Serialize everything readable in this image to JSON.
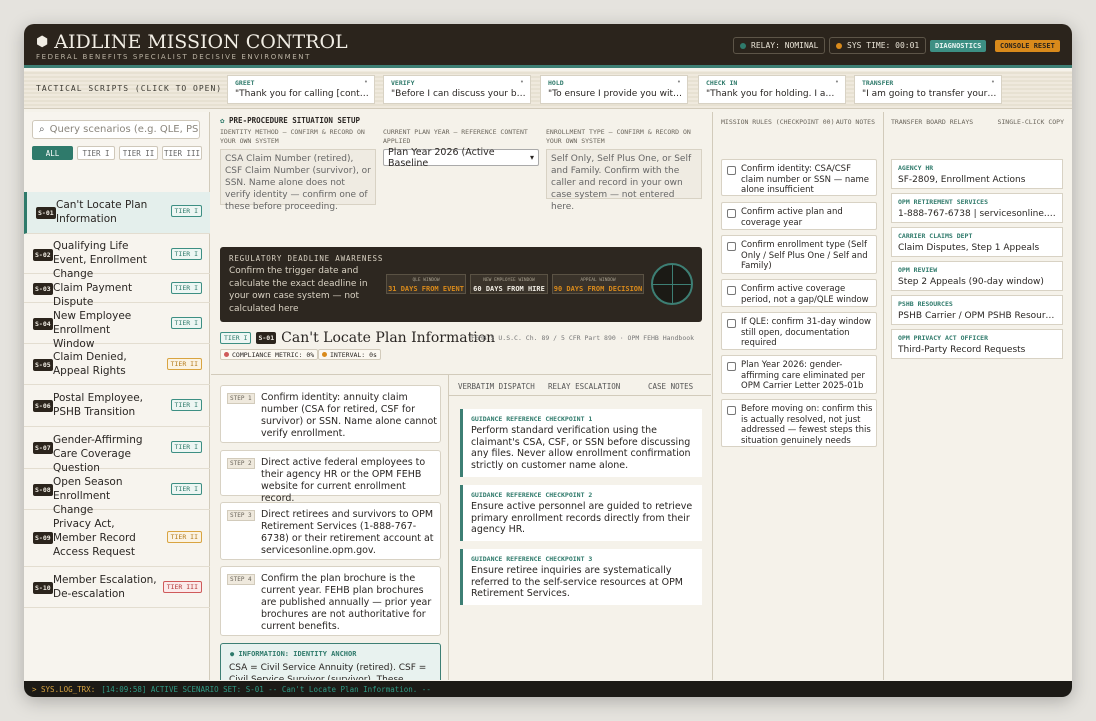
{
  "header": {
    "title": "AIDLINE MISSION CONTROL",
    "subtitle": "FEDERAL BENEFITS SPECIALIST DECISIVE ENVIRONMENT",
    "relay": "RELAY: NOMINAL",
    "systime": "SYS TIME: 00:01",
    "diagnostics": "DIAGNOSTICS",
    "reset": "CONSOLE RESET",
    "relay_color": "#2f7a6b",
    "time_color": "#d98a1b"
  },
  "scripts": {
    "label": "TACTICAL SCRIPTS (CLICK TO OPEN)",
    "items": [
      {
        "key": "GREET",
        "text": "\"Thank you for calling [contac..."
      },
      {
        "key": "VERIFY",
        "text": "\"Before I can discuss your be..."
      },
      {
        "key": "HOLD",
        "text": "\"To ensure I provide you with ..."
      },
      {
        "key": "CHECK IN",
        "text": "\"Thank you for holding. I am s..."
      },
      {
        "key": "TRANSFER",
        "text": "\"I am going to transfer your in..."
      }
    ]
  },
  "sidebar": {
    "search_placeholder": "Query scenarios (e.g. QLE, PSHB)",
    "filters": [
      "ALL",
      "TIER I",
      "TIER II",
      "TIER III"
    ],
    "items": [
      {
        "id": "S-01",
        "title": "Can't Locate Plan Information",
        "tier": "TIER I"
      },
      {
        "id": "S-02",
        "title": "Qualifying Life Event, Enrollment Change",
        "tier": "TIER I"
      },
      {
        "id": "S-03",
        "title": "Claim Payment Dispute",
        "tier": "TIER I"
      },
      {
        "id": "S-04",
        "title": "New Employee Enrollment Window",
        "tier": "TIER I"
      },
      {
        "id": "S-05",
        "title": "Claim Denied, Appeal Rights",
        "tier": "TIER II"
      },
      {
        "id": "S-06",
        "title": "Postal Employee, PSHB Transition",
        "tier": "TIER I"
      },
      {
        "id": "S-07",
        "title": "Gender-Affirming Care Coverage Question",
        "tier": "TIER I"
      },
      {
        "id": "S-08",
        "title": "Open Season Enrollment Change",
        "tier": "TIER I"
      },
      {
        "id": "S-09",
        "title": "Privacy Act, Member Record Access Request",
        "tier": "TIER II"
      },
      {
        "id": "S-10",
        "title": "Member Escalation, De-escalation",
        "tier": "TIER III"
      }
    ]
  },
  "setup": {
    "heading": "PRE-PROCEDURE SITUATION SETUP",
    "identity_label": "IDENTITY METHOD — CONFIRM & RECORD ON YOUR OWN SYSTEM",
    "identity_text": "CSA Claim Number (retired), CSF Claim Number (survivor), or SSN. Name alone does not verify identity — confirm one of these before proceeding.",
    "plan_label": "CURRENT PLAN YEAR — REFERENCE CONTENT APPLIED",
    "plan_value": "Plan Year 2026 (Active Baseline",
    "enroll_label": "ENROLLMENT TYPE — CONFIRM & RECORD ON YOUR OWN SYSTEM",
    "enroll_text": "Self Only, Self Plus One, or Self and Family. Confirm with the caller and record in your own case system — not entered here."
  },
  "deadline": {
    "heading": "REGULATORY DEADLINE AWARENESS",
    "body": "Confirm the trigger date and calculate the exact deadline in your own case system — not calculated here",
    "windows": [
      {
        "label": "QLE WINDOW",
        "value": "31 DAYS FROM EVENT",
        "color": "#d98a1b"
      },
      {
        "label": "NEW EMPLOYEE WINDOW",
        "value": "60 DAYS FROM HIRE",
        "color": "#f1ede4"
      },
      {
        "label": "APPEAL WINDOW",
        "value": "90 DAYS FROM DECISION",
        "color": "#d98a1b"
      }
    ]
  },
  "scenario": {
    "tier": "TIER I",
    "id": "S-01",
    "title": "Can't Locate Plan Information",
    "ref": "FEHB 5 U.S.C. Ch. 89 / 5 CFR Part 890 · OPM FEHB Handbook",
    "metric": "COMPLIANCE METRIC: 0%",
    "interval": "INTERVAL: 0s"
  },
  "steps": [
    {
      "n": "STEP 1",
      "text": "Confirm identity: annuity claim number (CSA for retired, CSF for survivor) or SSN. Name alone cannot verify enrollment."
    },
    {
      "n": "STEP 2",
      "text": "Direct active federal employees to their agency HR or the OPM FEHB website for current enrollment record."
    },
    {
      "n": "STEP 3",
      "text": "Direct retirees and survivors to OPM Retirement Services (1-888-767-6738) or their retirement account at servicesonline.opm.gov."
    },
    {
      "n": "STEP 4",
      "text": "Confirm the plan brochure is the current year. FEHB plan brochures are published annually — prior year brochures are not authoritative for current benefits."
    }
  ],
  "info": {
    "heading": "INFORMATION: IDENTITY ANCHOR",
    "text": "CSA = Civil Service Annuity (retired). CSF = Civil Service Survivor (survivor). These numbers plus SSN are the two-point identity confirmation for FEHB. Do not proceed on name alone."
  },
  "tabs": [
    "VERBATIM DISPATCH",
    "RELAY ESCALATION",
    "CASE NOTES"
  ],
  "guidance": [
    {
      "h": "GUIDANCE REFERENCE CHECKPOINT 1",
      "t": "Perform standard verification using the claimant's CSA, CSF, or SSN before discussing any files. Never allow enrollment confirmation strictly on customer name alone."
    },
    {
      "h": "GUIDANCE REFERENCE CHECKPOINT 2",
      "t": "Ensure active personnel are guided to retrieve primary enrollment records directly from their agency HR."
    },
    {
      "h": "GUIDANCE REFERENCE CHECKPOINT 3",
      "t": "Ensure retiree inquiries are systematically referred to the self-service resources at OPM Retirement Services."
    }
  ],
  "rules": {
    "heading": "MISSION RULES (CHECKPOINT 00)",
    "auto": "AUTO NOTES",
    "items": [
      "Confirm identity: CSA/CSF claim number or SSN — name alone insufficient",
      "Confirm active plan and coverage year",
      "Confirm enrollment type (Self Only / Self Plus One / Self and Family)",
      "Confirm active coverage period, not a gap/QLE window",
      "If QLE: confirm 31-day window still open, documentation required",
      "Plan Year 2026: gender-affirming care eliminated per OPM Carrier Letter 2025-01b",
      "Before moving on: confirm this is actually resolved, not just addressed — fewest steps this situation genuinely needs"
    ]
  },
  "relays": {
    "heading": "TRANSFER BOARD RELAYS",
    "copy": "SINGLE-CLICK COPY",
    "items": [
      {
        "k": "AGENCY HR",
        "v": "SF-2809, Enrollment Actions"
      },
      {
        "k": "OPM RETIREMENT SERVICES",
        "v": "1-888-767-6738 | servicesonline.opm.gov"
      },
      {
        "k": "CARRIER CLAIMS DEPT",
        "v": "Claim Disputes, Step 1 Appeals"
      },
      {
        "k": "OPM REVIEW",
        "v": "Step 2 Appeals (90-day window)"
      },
      {
        "k": "PSHB RESOURCES",
        "v": "PSHB Carrier / OPM PSHB Resources"
      },
      {
        "k": "OPM PRIVACY ACT OFFICER",
        "v": "Third-Party Record Requests"
      }
    ]
  },
  "log": {
    "prefix": "> SYS.LOG_TRX:",
    "text": "[14:09:58] ACTIVE SCENARIO SET: S-01 -- Can't Locate Plan Information. --"
  }
}
